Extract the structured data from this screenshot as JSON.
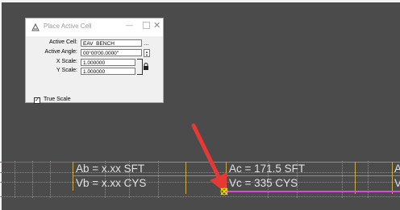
{
  "dialog": {
    "title": "Place Active Cell",
    "minimize_glyph": "—",
    "close_glyph": "✕",
    "fields": {
      "active_cell": {
        "label": "Active Cell:",
        "value": "EAV_BENCH"
      },
      "active_angle": {
        "label": "Active Angle:",
        "value": "00°00'00.0000\""
      },
      "x_scale": {
        "label": "X Scale:",
        "value": "1.000000"
      },
      "y_scale": {
        "label": "Y Scale:",
        "value": "1.000000"
      }
    },
    "browse_label": "...",
    "true_scale": {
      "label": "True Scale",
      "checked": true
    }
  },
  "table": {
    "left_row1": "Ab = x.xx SFT",
    "left_row2": "Vb = x.xx CYS",
    "right_row1": "Ac = 171.5 SFT",
    "right_row2": "Vc = 335 CYS",
    "edge_row1": "A",
    "edge_row2": "V"
  },
  "colors": {
    "background": "#4b4b4b",
    "arrow": "#e53935",
    "magenta_line": "#d84bd8",
    "blue_line": "#4a6de0"
  }
}
